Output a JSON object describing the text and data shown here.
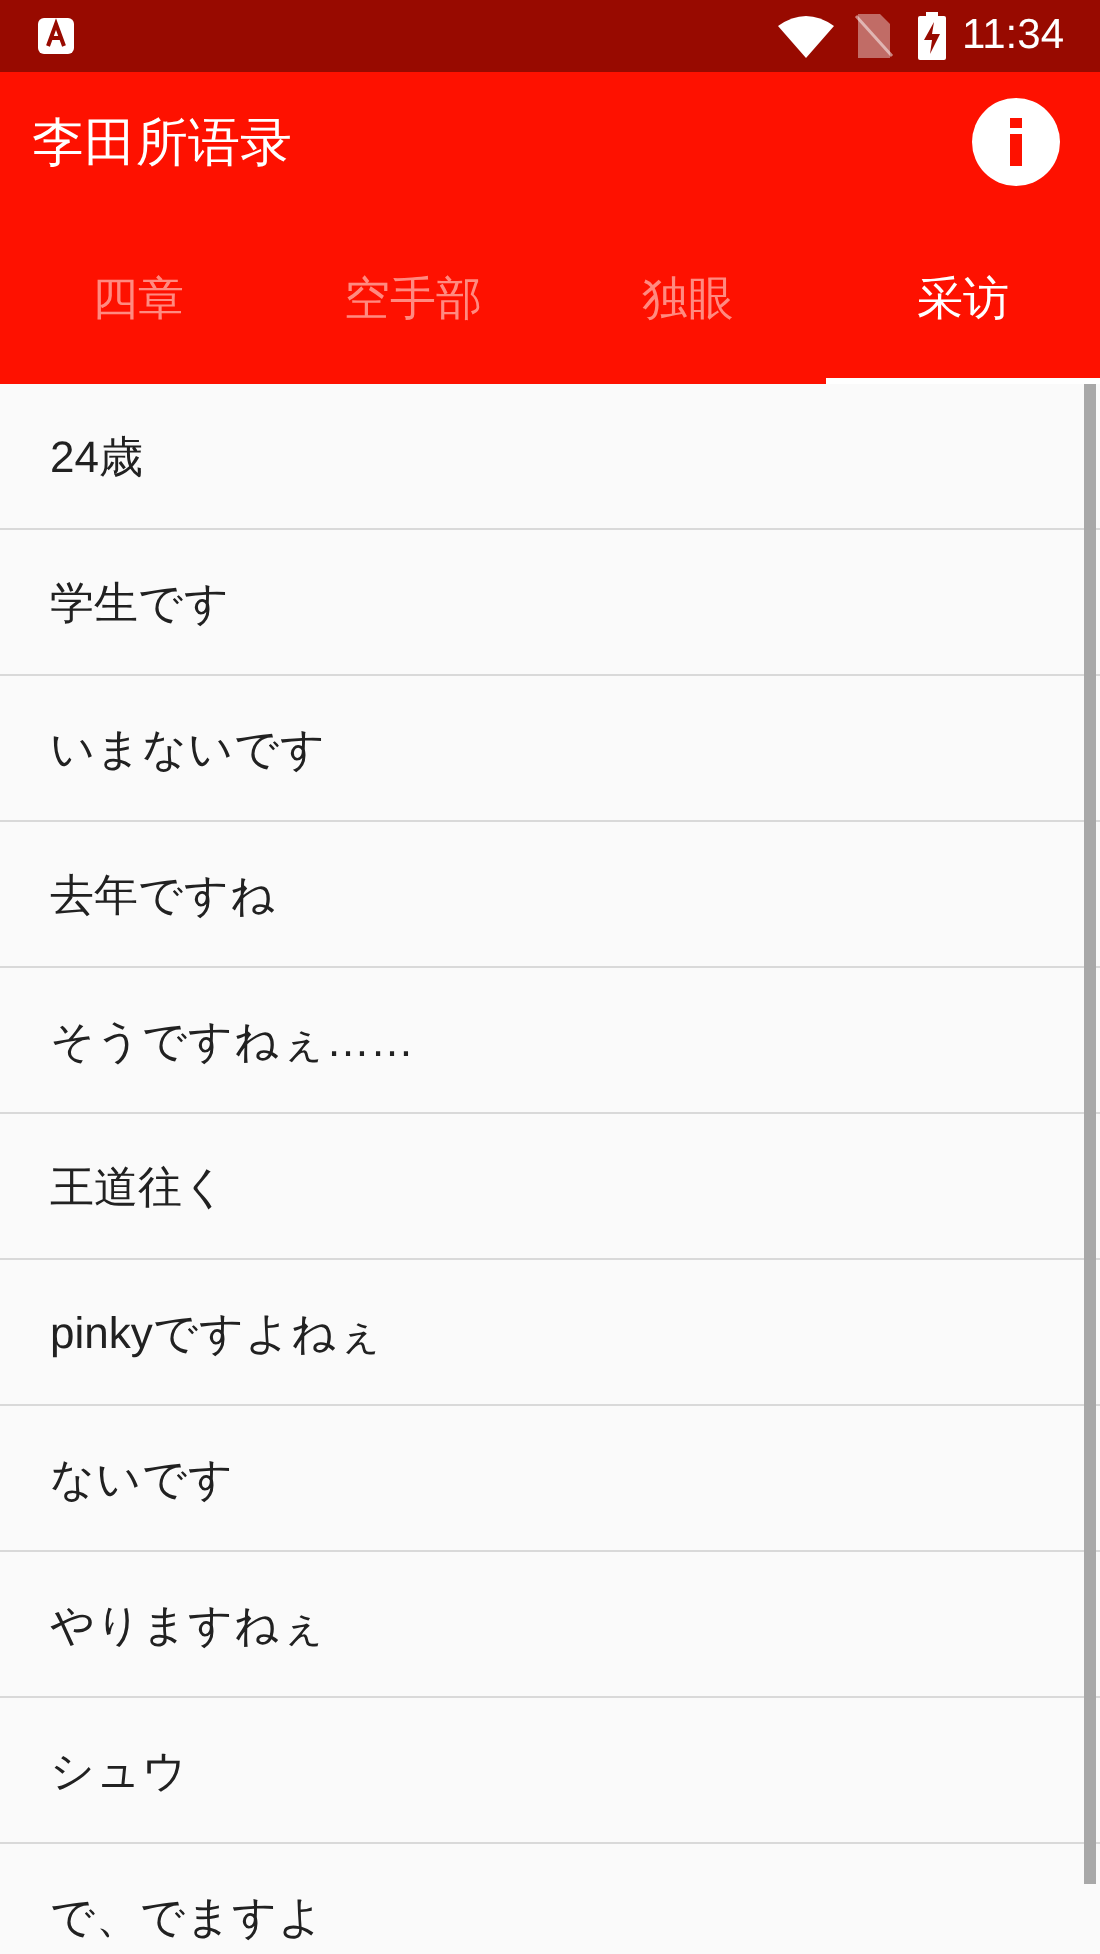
{
  "status_bar": {
    "time": "11:34"
  },
  "app_bar": {
    "title": "李田所语录"
  },
  "tabs": [
    {
      "label": "四章",
      "selected": false
    },
    {
      "label": "空手部",
      "selected": false
    },
    {
      "label": "独眼",
      "selected": false
    },
    {
      "label": "采访",
      "selected": true
    }
  ],
  "list": {
    "items": [
      "24歳",
      "学生です",
      "いまないです",
      "去年ですね",
      "そうですねぇ……",
      "王道往く",
      "pinkyですよねぇ",
      "ないです",
      "やりますねぇ",
      "シュウ",
      "で、でますよ"
    ]
  }
}
